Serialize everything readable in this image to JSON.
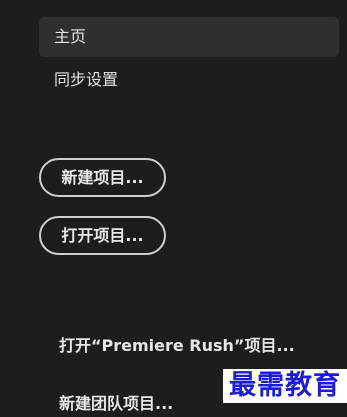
{
  "nav": {
    "items": [
      {
        "label": "主页",
        "active": true
      },
      {
        "label": "同步设置",
        "active": false
      }
    ]
  },
  "actions": {
    "new_project": "新建项目...",
    "open_project": "打开项目...",
    "open_rush_project": "打开“Premiere Rush”项目...",
    "new_team_project": "新建团队项目..."
  },
  "watermark": {
    "text": "最需教育"
  },
  "colors": {
    "background": "#1d1d1d",
    "active_item": "#2f2f2f",
    "pill_border": "#cfcfcf",
    "watermark_text": "#1c1cd8"
  }
}
